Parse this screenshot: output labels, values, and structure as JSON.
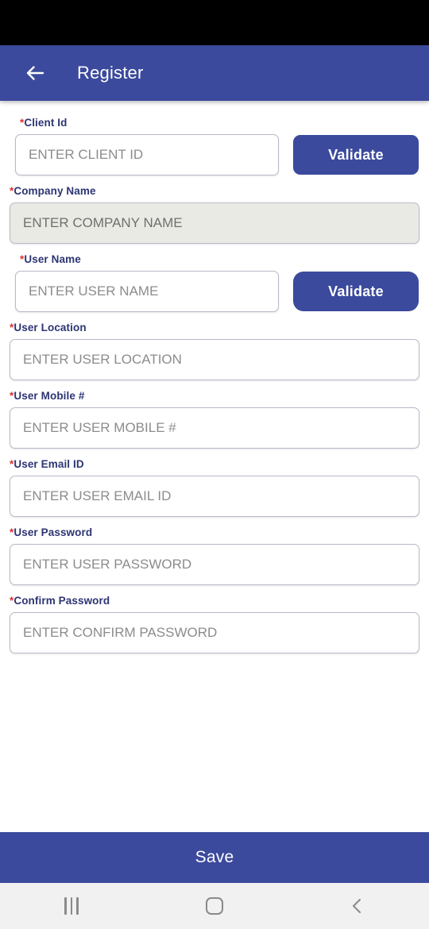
{
  "app_bar": {
    "title": "Register",
    "back_icon": "arrow-left-icon",
    "background_color": "#3b4a9d"
  },
  "status_bar": {
    "background_color": "#000000"
  },
  "form": {
    "required_marker": "*",
    "fields": [
      {
        "label": "Client Id",
        "required": true,
        "placeholder": "ENTER CLIENT ID",
        "value": "",
        "disabled": false,
        "has_validate_button": true,
        "validate_label": "Validate"
      },
      {
        "label": "Company Name",
        "required": true,
        "placeholder": "ENTER COMPANY NAME",
        "value": "",
        "disabled": true,
        "has_validate_button": false,
        "validate_label": ""
      },
      {
        "label": "User Name",
        "required": true,
        "placeholder": "ENTER USER NAME",
        "value": "",
        "disabled": false,
        "has_validate_button": true,
        "validate_label": "Validate"
      },
      {
        "label": "User Location",
        "required": true,
        "placeholder": "ENTER USER LOCATION",
        "value": "",
        "disabled": false,
        "has_validate_button": false,
        "validate_label": ""
      },
      {
        "label": "User Mobile #",
        "required": true,
        "placeholder": "ENTER USER MOBILE #",
        "value": "",
        "disabled": false,
        "has_validate_button": false,
        "validate_label": ""
      },
      {
        "label": "User Email ID",
        "required": true,
        "placeholder": "ENTER USER EMAIL ID",
        "value": "",
        "disabled": false,
        "has_validate_button": false,
        "validate_label": ""
      },
      {
        "label": "User Password",
        "required": true,
        "placeholder": "ENTER USER PASSWORD",
        "value": "",
        "disabled": false,
        "has_validate_button": false,
        "validate_label": ""
      },
      {
        "label": "Confirm Password",
        "required": true,
        "placeholder": "ENTER CONFIRM PASSWORD",
        "value": "",
        "disabled": false,
        "has_validate_button": false,
        "validate_label": ""
      }
    ]
  },
  "save_bar": {
    "label": "Save",
    "background_color": "#3b4a9d"
  },
  "nav_bar": {
    "recents_icon": "recents-icon",
    "home_icon": "home-icon",
    "back_icon": "back-chevron-icon",
    "background_color": "#f1f1f1"
  },
  "colors": {
    "primary": "#3b4a9d",
    "label_text": "#2d3473",
    "required_star": "#e03030",
    "placeholder": "#8c8c8c",
    "disabled_field": "#eaeae4",
    "field_border": "#b9b9c9"
  }
}
